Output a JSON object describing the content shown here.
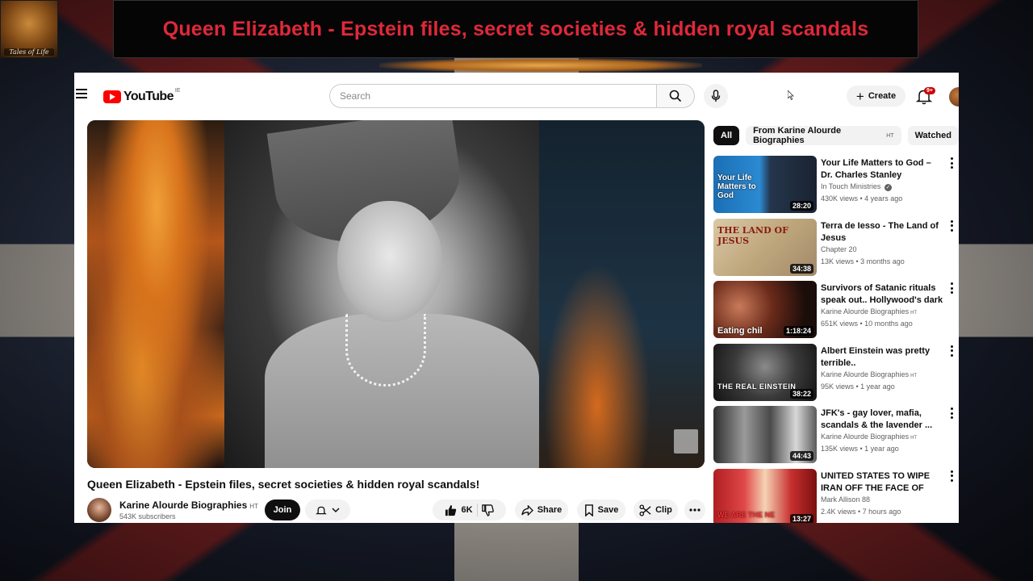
{
  "overlay": {
    "banner_title": "Queen Elizabeth - Epstein files, secret societies & hidden royal scandals",
    "logo_text": "Tales of Life"
  },
  "header": {
    "logo_word": "YouTube",
    "region": "IE",
    "search_placeholder": "Search",
    "create_label": "Create",
    "notif_count": "9+"
  },
  "video": {
    "title": "Queen Elizabeth - Epstein files, secret societies & hidden royal scandals!",
    "channel_name": "Karine Alourde Biographies",
    "channel_badge": "HT",
    "subscribers": "543K subscribers",
    "join_label": "Join",
    "likes": "6K",
    "share_label": "Share",
    "save_label": "Save",
    "clip_label": "Clip"
  },
  "sidebar": {
    "chips": [
      {
        "label": "All",
        "active": true
      },
      {
        "label": "From Karine Alourde Biographies",
        "badge": "HT"
      },
      {
        "label": "Watched"
      }
    ],
    "items": [
      {
        "title": "Your Life Matters to God – Dr. Charles Stanley",
        "channel": "In Touch Ministries",
        "meta": "430K views • 4 years ago",
        "duration": "28:20",
        "thumb_text": "Your Life Matters to God"
      },
      {
        "title": "Terra de Iesso  - The Land of Jesus",
        "channel": "Chapter 20",
        "meta": "13K views • 3 months ago",
        "duration": "34:38",
        "thumb_text": "THE LAND OF JESUS"
      },
      {
        "title": "Survivors of Satanic rituals speak out.. Hollywood's dark ...",
        "channel": "Karine Alourde Biographies",
        "meta": "651K views • 10 months ago",
        "duration": "1:18:24",
        "thumb_text": "Eating chil"
      },
      {
        "title": "Albert Einstein was pretty terrible..",
        "channel": "Karine Alourde Biographies",
        "meta": "95K views • 1 year ago",
        "duration": "38:22",
        "thumb_text": "THE REAL EINSTEIN"
      },
      {
        "title": "JFK's - gay lover, mafia, scandals & the lavender  ...",
        "channel": "Karine Alourde Biographies",
        "meta": "135K views • 1 year ago",
        "duration": "44:43",
        "thumb_text": ""
      },
      {
        "title": "UNITED STATES TO WIPE IRAN OFF THE FACE OF THE EARTH...",
        "channel": "Mark Allison 88",
        "meta": "2.4K views • 7 hours ago",
        "duration": "13:27",
        "thumb_text": "WE ARE THE NE"
      }
    ]
  }
}
